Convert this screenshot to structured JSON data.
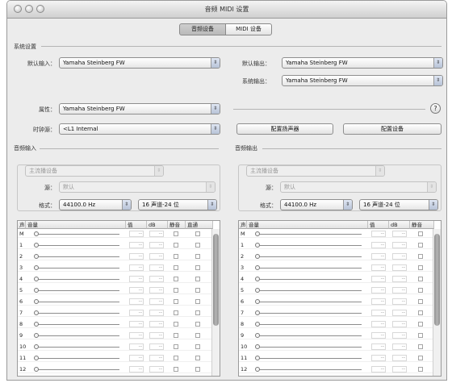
{
  "window": {
    "title": "音频 MIDI 设置"
  },
  "tabs": [
    {
      "label": "音频设备",
      "active": true
    },
    {
      "label": "MIDI 设备",
      "active": false
    }
  ],
  "system_settings": {
    "section_label": "系统设置",
    "default_input_label": "默认输入：",
    "default_input_value": "Yamaha Steinberg FW",
    "default_output_label": "默认输出：",
    "default_output_value": "Yamaha Steinberg FW",
    "system_output_label": "系统输出：",
    "system_output_value": "Yamaha Steinberg FW"
  },
  "device": {
    "properties_label": "属性：",
    "properties_value": "Yamaha Steinberg FW",
    "clock_label": "时钟源：",
    "clock_value": "<L1 Internal",
    "configure_speakers_button": "配置扬声器",
    "configure_device_button": "配置设备",
    "help_glyph": "?"
  },
  "audio_input": {
    "section_label": "音频输入",
    "stream_popup": "主流播设备",
    "source_label": "源：",
    "source_value": "默认",
    "format_label": "格式：",
    "rate": "44100.0 Hz",
    "channels": "16 声道-24 位",
    "columns": [
      "声",
      "音量",
      "值",
      "dB",
      "静音",
      "直通"
    ]
  },
  "audio_output": {
    "section_label": "音频输出",
    "stream_popup": "主流播设备",
    "source_label": "源：",
    "source_value": "默认",
    "format_label": "格式：",
    "rate": "44100.0 Hz",
    "channels": "16 声道-24 位",
    "columns": [
      "声",
      "音量",
      "值",
      "dB",
      "静音"
    ]
  },
  "channel_rows": [
    "M",
    "1",
    "2",
    "3",
    "4",
    "5",
    "6",
    "7",
    "8",
    "9",
    "10",
    "11",
    "12"
  ],
  "cell_placeholder": "--"
}
